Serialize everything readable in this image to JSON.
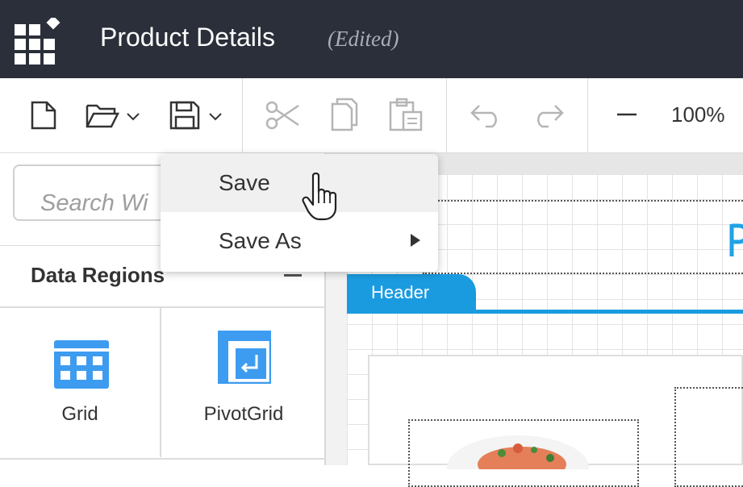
{
  "window": {
    "title": "Product Details",
    "status": "(Edited)"
  },
  "toolbar": {
    "items": [
      {
        "icon": "new-file-icon"
      },
      {
        "icon": "open-folder-icon"
      },
      {
        "icon": "save-icon"
      },
      {
        "icon": "cut-icon"
      },
      {
        "icon": "copy-icon"
      },
      {
        "icon": "paste-icon"
      },
      {
        "icon": "undo-icon"
      },
      {
        "icon": "redo-icon"
      },
      {
        "icon": "zoom-out-icon"
      }
    ],
    "zoom_level": "100%"
  },
  "save_menu": {
    "items": [
      {
        "label": "Save",
        "highlighted": true
      },
      {
        "label": "Save As",
        "has_submenu": true
      }
    ]
  },
  "sidebar": {
    "search_placeholder": "Search Wi",
    "section_title": "Data Regions",
    "widgets": [
      {
        "label": "Grid",
        "icon": "grid-icon",
        "color": "#3d9cf0"
      },
      {
        "label": "PivotGrid",
        "icon": "pivotgrid-icon",
        "color": "#3d9cf0"
      }
    ]
  },
  "design": {
    "header_tab_label": "Header",
    "accent_color": "#1a9be0"
  }
}
